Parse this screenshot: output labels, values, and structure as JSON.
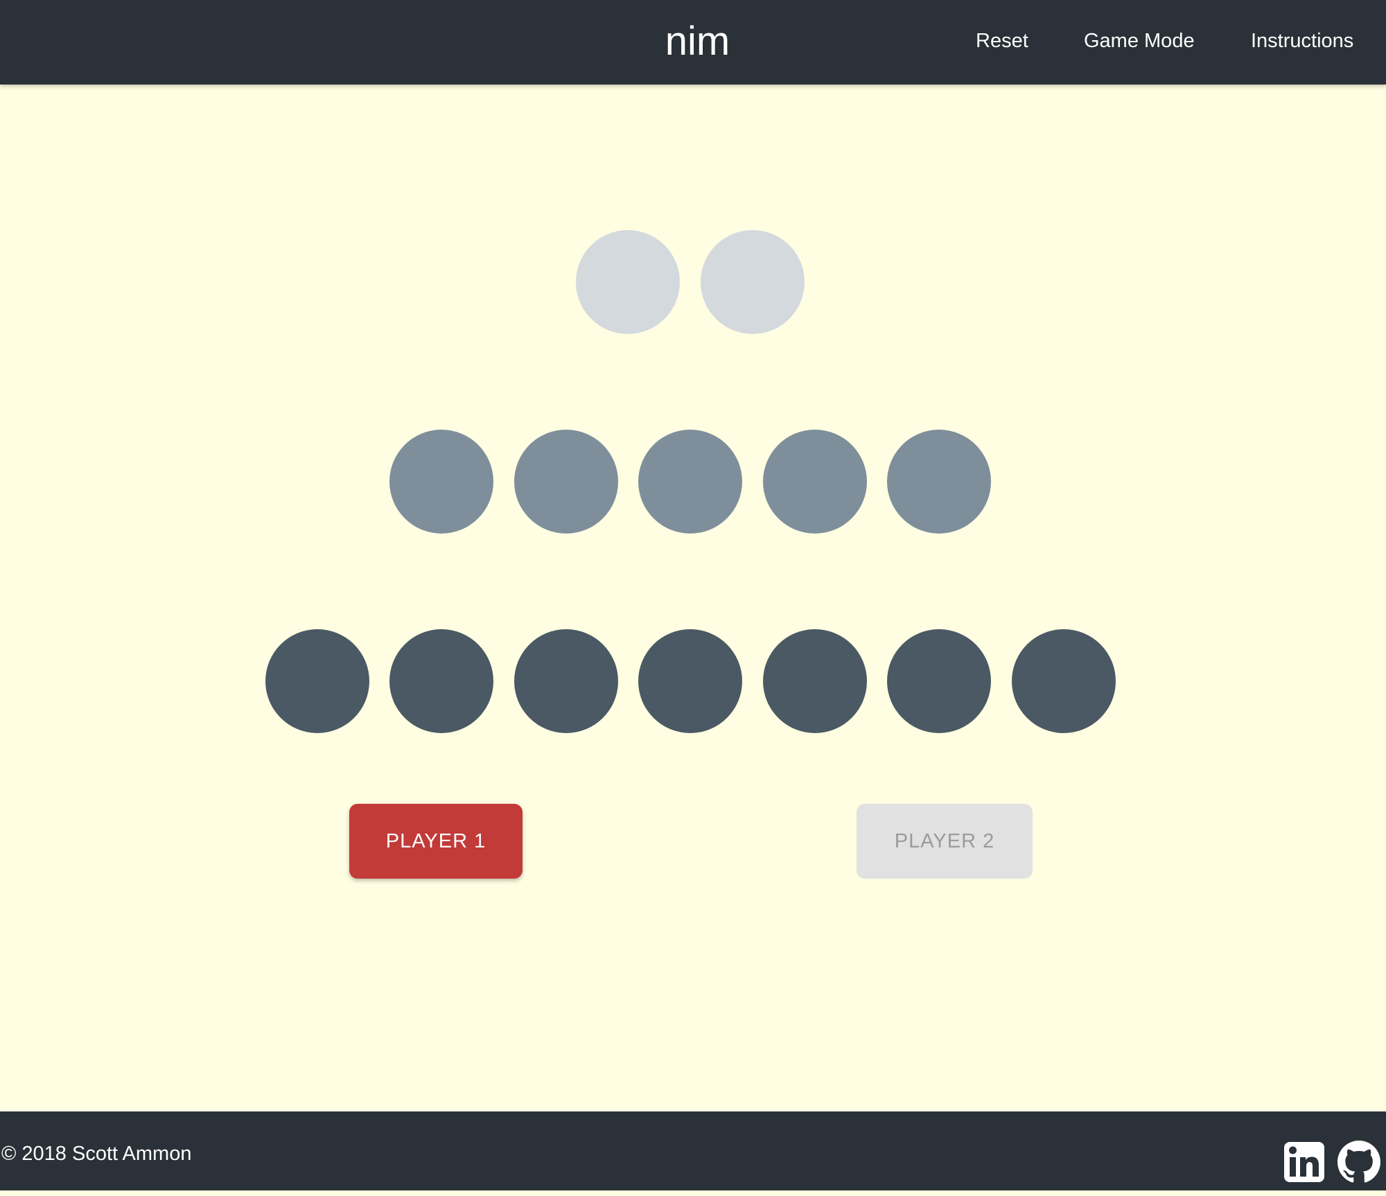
{
  "navbar": {
    "title": "nim",
    "links": [
      "Reset",
      "Game Mode",
      "Instructions"
    ]
  },
  "board": {
    "rows": [
      {
        "count": 2,
        "color": "#d3d9dd"
      },
      {
        "count": 5,
        "color": "#7e8f9b"
      },
      {
        "count": 7,
        "color": "#4a5963"
      }
    ]
  },
  "players": {
    "player1": {
      "label": "PLAYER 1",
      "active": true,
      "color": "#c23b38"
    },
    "player2": {
      "label": "PLAYER 2",
      "active": false,
      "color": "#e1e1e1"
    }
  },
  "footer": {
    "copyright": "© 2018 Scott Ammon",
    "icons": [
      "linkedin-icon",
      "github-icon"
    ]
  },
  "colors": {
    "background": "#fffde2",
    "bars": "#2a3138"
  }
}
